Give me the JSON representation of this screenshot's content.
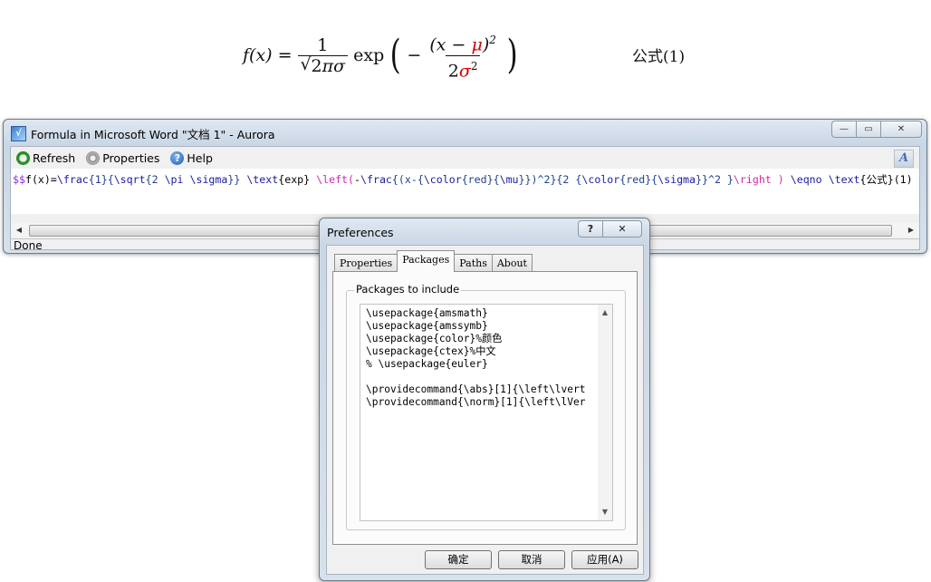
{
  "document": {
    "formula": {
      "lhs": "f(x) = ",
      "num1": "1",
      "den_coef": "2",
      "den_pi": "πσ",
      "exp": "exp",
      "minus": "−",
      "inner_num": "(x − ",
      "mu": "μ",
      "inner_num_close": ")",
      "sq": "2",
      "inner_den_coef": "2",
      "sigma": "σ",
      "sq2": "2"
    },
    "eqno": "公式(1)"
  },
  "window": {
    "title": "Formula in Microsoft Word \"文档 1\" - Aurora",
    "caption": {
      "minimize": "—",
      "maximize": "▭",
      "close": "✕"
    },
    "toolbar": {
      "refresh": "Refresh",
      "properties": "Properties",
      "help": "Help",
      "font_button": "A"
    },
    "editor": {
      "parts": {
        "p1": "$$",
        "p2": "f(x)=",
        "p3": "\\frac",
        "p4": "{1}{",
        "p5": "\\sqrt",
        "p6": "{2 ",
        "p7": "\\pi \\sigma",
        "p8": "}} ",
        "p9": "\\text",
        "p10": "{exp} ",
        "p11": "\\left(",
        "p12": "-",
        "p13": "\\frac",
        "p14": "{(x-{",
        "p15": "\\color",
        "p16": "{red}{",
        "p17": "\\mu",
        "p18": "}})^2}{2 {",
        "p19": "\\color",
        "p20": "{red}{",
        "p21": "\\sigma",
        "p22": "}}^2 }",
        "p23": "\\right )",
        "p24": " \\eqno ",
        "p25": "\\text",
        "p26": "{公式}(1)"
      }
    },
    "status": "Done"
  },
  "dialog": {
    "title": "Preferences",
    "help_btn": "?",
    "close_btn": "✕",
    "tabs": [
      "Properties",
      "Packages",
      "Paths",
      "About"
    ],
    "active_tab": "Packages",
    "group_label": "Packages to include",
    "packages_text": "\\usepackage{amsmath}\n\\usepackage{amssymb}\n\\usepackage{color}%颜色\n\\usepackage{ctex}%中文\n% \\usepackage{euler}\n\n\\providecommand{\\abs}[1]{\\left\\lvert\n\\providecommand{\\norm}[1]{\\left\\lVer",
    "buttons": {
      "ok": "确定",
      "cancel": "取消",
      "apply": "应用(A)"
    }
  },
  "colors": {
    "accent_red": "#d20000",
    "code_blue": "#1a1aa6",
    "code_magenta": "#d02aa8"
  }
}
